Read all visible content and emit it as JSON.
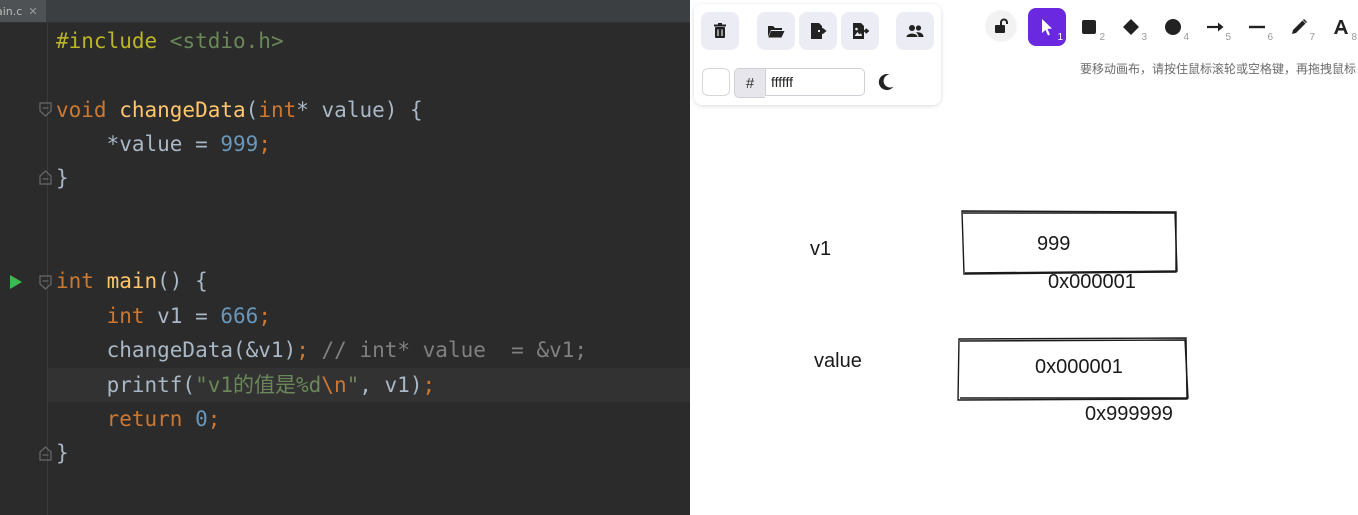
{
  "editor": {
    "tab_label": "ain.c",
    "tab_close": "✕",
    "lines": [
      {
        "tokens": [
          {
            "t": "#include ",
            "c": "pre"
          },
          {
            "t": "<stdio.h>",
            "c": "str"
          }
        ]
      },
      {
        "tokens": []
      },
      {
        "tokens": [
          {
            "t": "void ",
            "c": "kw"
          },
          {
            "t": "changeData",
            "c": "fn"
          },
          {
            "t": "(",
            "c": ""
          },
          {
            "t": "int",
            "c": "kw"
          },
          {
            "t": "* value) {",
            "c": ""
          }
        ]
      },
      {
        "tokens": [
          {
            "t": "    *value = ",
            "c": ""
          },
          {
            "t": "999",
            "c": "num"
          },
          {
            "t": ";",
            "c": "kw"
          }
        ]
      },
      {
        "tokens": [
          {
            "t": "}",
            "c": ""
          }
        ]
      },
      {
        "tokens": []
      },
      {
        "tokens": []
      },
      {
        "tokens": [
          {
            "t": "int ",
            "c": "kw"
          },
          {
            "t": "main",
            "c": "fn"
          },
          {
            "t": "() {",
            "c": ""
          }
        ]
      },
      {
        "tokens": [
          {
            "t": "    ",
            "c": ""
          },
          {
            "t": "int ",
            "c": "kw"
          },
          {
            "t": "v1 = ",
            "c": ""
          },
          {
            "t": "666",
            "c": "num"
          },
          {
            "t": ";",
            "c": "kw"
          }
        ]
      },
      {
        "tokens": [
          {
            "t": "    changeData(&v1)",
            "c": ""
          },
          {
            "t": "; ",
            "c": "kw"
          },
          {
            "t": "// int* value  = &v1;",
            "c": "cmt"
          }
        ]
      },
      {
        "tokens": [
          {
            "t": "    printf(",
            "c": ""
          },
          {
            "t": "\"v1的值是%d",
            "c": "str"
          },
          {
            "t": "\\n",
            "c": "esc"
          },
          {
            "t": "\"",
            "c": "str"
          },
          {
            "t": ", v1)",
            "c": ""
          },
          {
            "t": ";",
            "c": "kw"
          }
        ]
      },
      {
        "tokens": [
          {
            "t": "    ",
            "c": ""
          },
          {
            "t": "return ",
            "c": "kw"
          },
          {
            "t": "0",
            "c": "num"
          },
          {
            "t": ";",
            "c": "kw"
          }
        ]
      },
      {
        "tokens": [
          {
            "t": "}",
            "c": ""
          }
        ]
      }
    ]
  },
  "board": {
    "color_hash": "#",
    "color_value": "ffffff",
    "hint": "要移动画布，请按住鼠标滚轮或空格键，再拖拽鼠标",
    "tools": [
      {
        "name": "selection-tool",
        "icon": "cursor-icon",
        "num": "1",
        "active": true
      },
      {
        "name": "rectangle-tool",
        "icon": "square-icon",
        "num": "2"
      },
      {
        "name": "diamond-tool",
        "icon": "diamond-icon",
        "num": "3"
      },
      {
        "name": "ellipse-tool",
        "icon": "circle-icon",
        "num": "4"
      },
      {
        "name": "arrow-tool",
        "icon": "arrow-icon",
        "num": "5"
      },
      {
        "name": "line-tool",
        "icon": "line-icon",
        "num": "6"
      },
      {
        "name": "draw-tool",
        "icon": "pencil-icon",
        "num": "7"
      },
      {
        "name": "text-tool",
        "icon": "text-icon",
        "num": "8"
      }
    ],
    "canvas": {
      "v1_label": "v1",
      "v1_value": "999",
      "v1_address": "0x000001",
      "value_label": "value",
      "value_value": "0x000001",
      "value_address": "0x999999"
    },
    "accent_color": "#6a28e0"
  }
}
